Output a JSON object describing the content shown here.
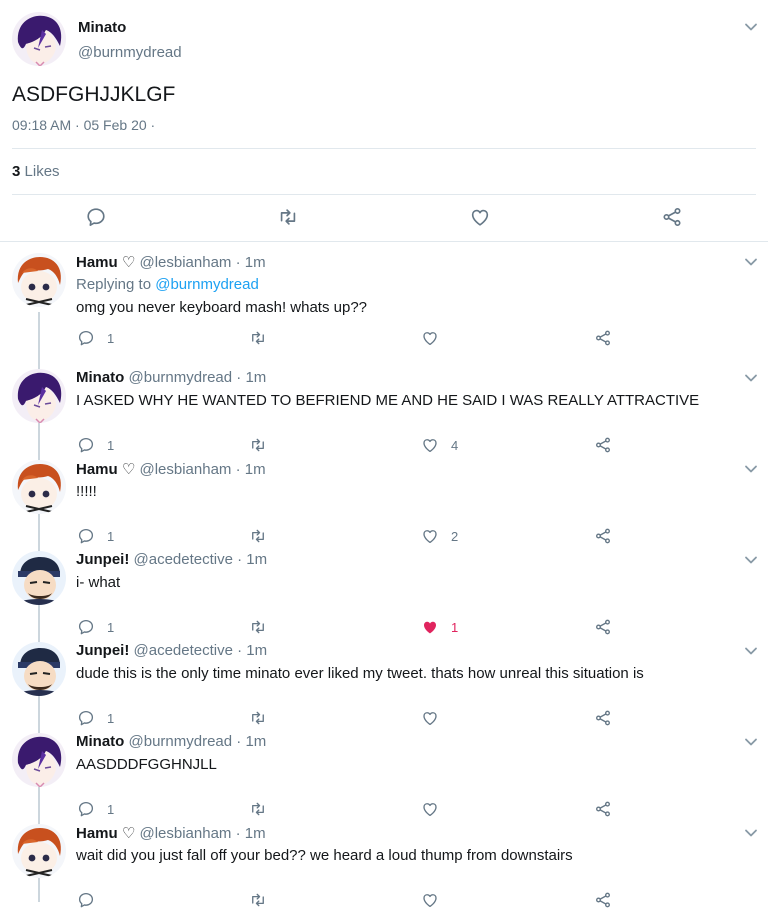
{
  "colors": {
    "accent": "#1da1f2",
    "like": "#e0245e",
    "muted": "#657786",
    "text": "#14171a",
    "divider": "#e1e8ed"
  },
  "main_tweet": {
    "name": "Minato",
    "handle": "@burnmydread",
    "text": "ASDFGHJJKLGF",
    "timestamp": "09:18 AM · 05 Feb 20 ·",
    "likes_count": "3",
    "likes_label": "Likes",
    "actions": [
      "reply-icon",
      "retweet-icon",
      "heart-icon",
      "share-icon"
    ]
  },
  "replies": [
    {
      "name": "Hamu ♡",
      "handle": "@lesbianham · 1m",
      "replying_prefix": "Replying to",
      "replying_to": "@burnmydread",
      "text": "omg you never keyboard mash! whats up??",
      "reply_count": "1",
      "like_count": "",
      "liked": false
    },
    {
      "name": "Minato",
      "handle": "@burnmydread · 1m",
      "text": "I ASKED WHY HE WANTED TO BEFRIEND ME AND HE SAID I WAS REALLY ATTRACTIVE",
      "reply_count": "1",
      "like_count": "4",
      "liked": false
    },
    {
      "name": "Hamu ♡",
      "handle": "@lesbianham · 1m",
      "text": "!!!!!",
      "reply_count": "1",
      "like_count": "2",
      "liked": false
    },
    {
      "name": "Junpei!",
      "handle": "@acedetective · 1m",
      "text": "i- what",
      "reply_count": "1",
      "like_count": "1",
      "liked": true
    },
    {
      "name": "Junpei!",
      "handle": "@acedetective · 1m",
      "text": "dude this is the only time minato ever liked my tweet. thats how unreal this situation is",
      "reply_count": "1",
      "like_count": "",
      "liked": false
    },
    {
      "name": "Minato",
      "handle": "@burnmydread · 1m",
      "text": "AASDDDFGGHNJLL",
      "reply_count": "1",
      "like_count": "",
      "liked": false
    },
    {
      "name": "Hamu ♡",
      "handle": "@lesbianham · 1m",
      "text": "wait did you just fall off your bed?? we heard a loud thump from downstairs",
      "reply_count": "",
      "like_count": "",
      "liked": false
    }
  ]
}
